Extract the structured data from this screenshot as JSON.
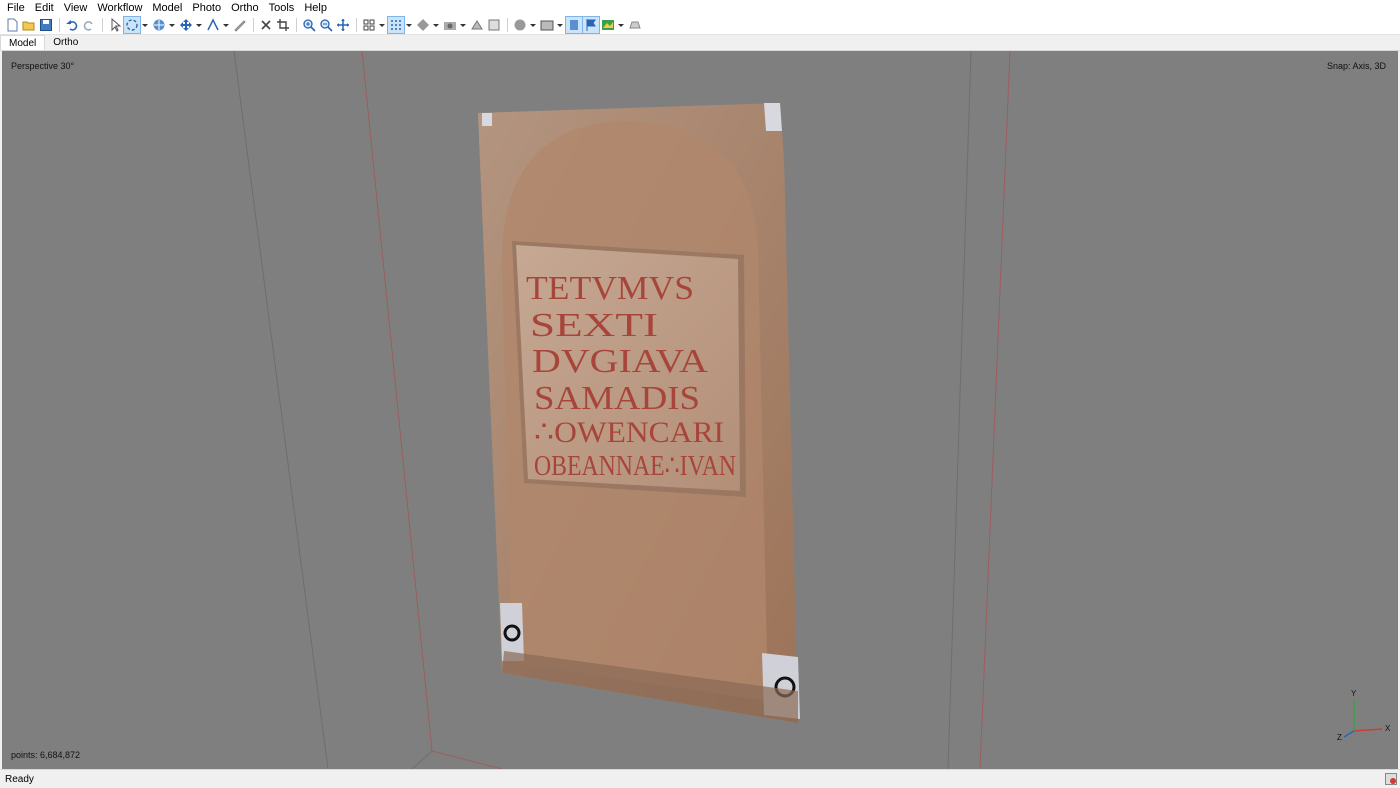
{
  "menu": [
    "File",
    "Edit",
    "View",
    "Workflow",
    "Model",
    "Photo",
    "Ortho",
    "Tools",
    "Help"
  ],
  "tabs": [
    {
      "label": "Model",
      "active": true
    },
    {
      "label": "Ortho",
      "active": false
    }
  ],
  "viewport": {
    "projection_label": "Perspective 30°",
    "snap_label": "Snap: Axis, 3D",
    "points_label": "points: 6,684,872",
    "background_color": "#7f7f7f",
    "axes": {
      "x": "X",
      "y": "Y",
      "z": "Z"
    }
  },
  "inscription": [
    "TETVMVS",
    "SEXTI",
    "DVGIAVA",
    "SAMADIS",
    "∴OWENCARI",
    "OBEANNAE∴IVAN"
  ],
  "status": {
    "text": "Ready"
  },
  "toolbar_icons": [
    "new-icon",
    "open-icon",
    "save-icon",
    "undo-icon",
    "redo-icon",
    "pointer-icon",
    "rotate-select-icon",
    "navigation-icon",
    "move-object-icon",
    "ruler-icon",
    "delete-icon",
    "crop-icon",
    "zoom-in-icon",
    "zoom-out-icon",
    "move-view-icon",
    "grid-view-icon",
    "point-cloud-icon",
    "shading-icon",
    "camera-icon",
    "texture-icon",
    "mask-icon",
    "sphere-icon",
    "photo-icon",
    "markers-icon",
    "flag-icon",
    "dem-icon",
    "shapes-icon"
  ]
}
